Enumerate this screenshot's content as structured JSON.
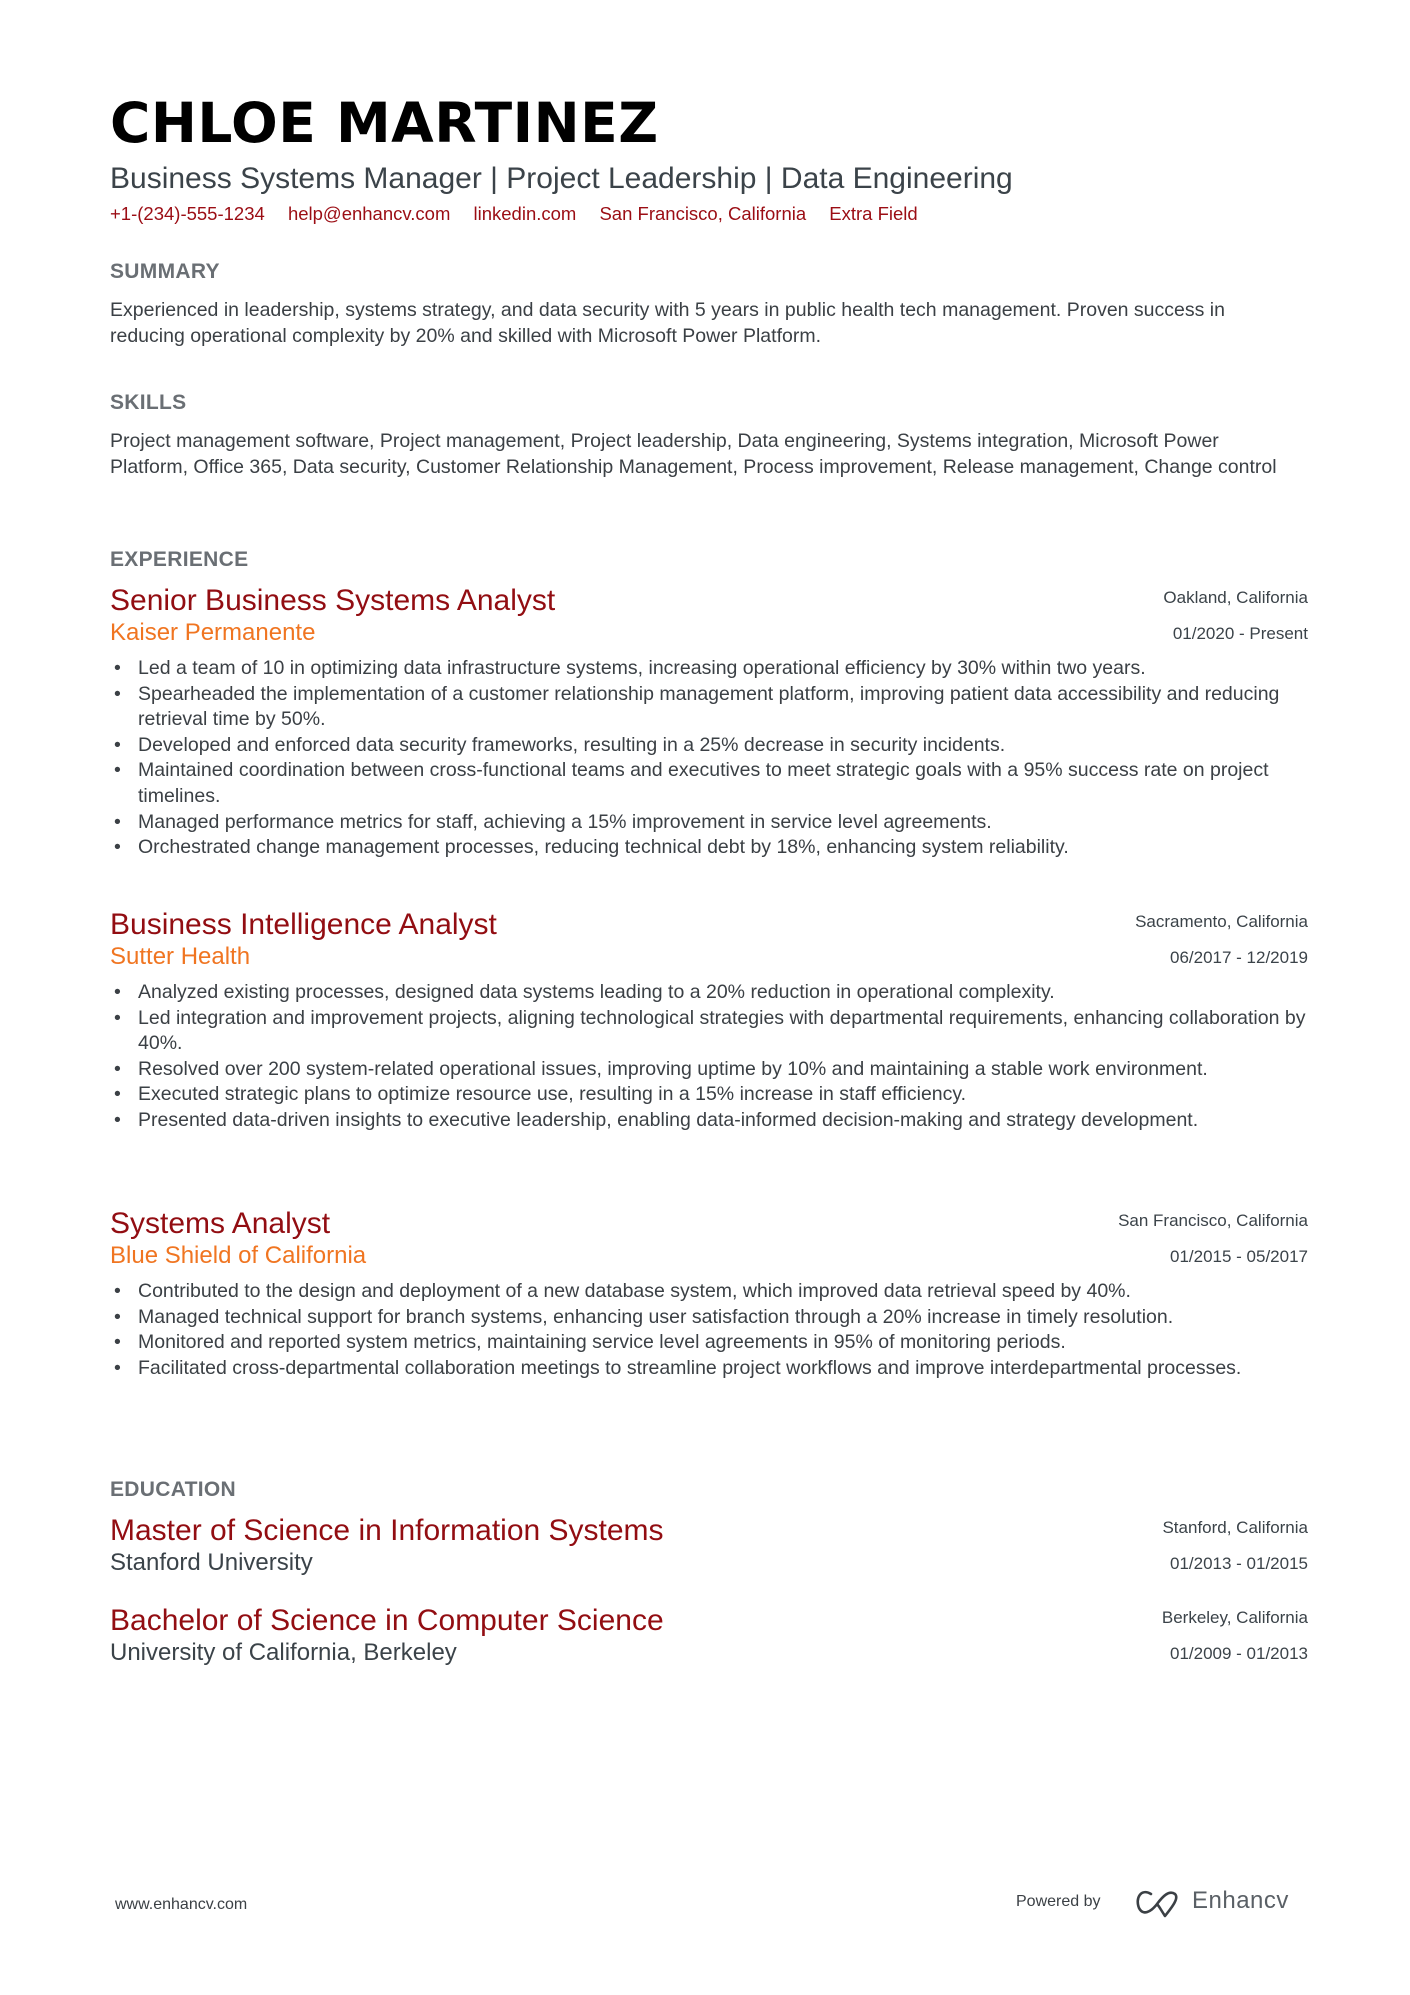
{
  "header": {
    "name": "CHLOE MARTINEZ",
    "subtitle": "Business Systems Manager | Project Leadership | Data Engineering",
    "contacts": [
      "+1-(234)-555-1234",
      "help@enhancv.com",
      "linkedin.com",
      "San Francisco, California",
      "Extra Field"
    ]
  },
  "colors": {
    "title": "#920d12",
    "company": "#f07521",
    "heading": "#6a6f74",
    "contact": "#9b0d14",
    "body": "#3b4045"
  },
  "summary": {
    "heading": "SUMMARY",
    "text": "Experienced in leadership, systems strategy, and data security with 5 years in public health tech management. Proven success in reducing operational complexity by 20% and skilled with Microsoft Power Platform."
  },
  "skills": {
    "heading": "SKILLS",
    "text": "Project management software, Project management, Project leadership, Data engineering, Systems integration, Microsoft Power Platform, Office 365, Data security, Customer Relationship Management, Process improvement, Release management, Change control"
  },
  "experience": {
    "heading": "EXPERIENCE",
    "items": [
      {
        "title": "Senior Business Systems Analyst",
        "company": "Kaiser Permanente",
        "location": "Oakland, California",
        "dates": "01/2020 - Present",
        "bullets": [
          "Led a team of 10 in optimizing data infrastructure systems, increasing operational efficiency by 30% within two years.",
          "Spearheaded the implementation of a customer relationship management platform, improving patient data accessibility and reducing retrieval time by 50%.",
          "Developed and enforced data security frameworks, resulting in a 25% decrease in security incidents.",
          "Maintained coordination between cross-functional teams and executives to meet strategic goals with a 95% success rate on project timelines.",
          "Managed performance metrics for staff, achieving a 15% improvement in service level agreements.",
          "Orchestrated change management processes, reducing technical debt by 18%, enhancing system reliability."
        ]
      },
      {
        "title": "Business Intelligence Analyst",
        "company": "Sutter Health",
        "location": "Sacramento, California",
        "dates": "06/2017 - 12/2019",
        "bullets": [
          "Analyzed existing processes, designed data systems leading to a 20% reduction in operational complexity.",
          "Led integration and improvement projects, aligning technological strategies with departmental requirements, enhancing collaboration by 40%.",
          "Resolved over 200 system-related operational issues, improving uptime by 10% and maintaining a stable work environment.",
          "Executed strategic plans to optimize resource use, resulting in a 15% increase in staff efficiency.",
          "Presented data-driven insights to executive leadership, enabling data-informed decision-making and strategy development."
        ]
      },
      {
        "title": "Systems Analyst",
        "company": "Blue Shield of California",
        "location": "San Francisco, California",
        "dates": "01/2015 - 05/2017",
        "bullets": [
          "Contributed to the design and deployment of a new database system, which improved data retrieval speed by 40%.",
          "Managed technical support for branch systems, enhancing user satisfaction through a 20% increase in timely resolution.",
          "Monitored and reported system metrics, maintaining service level agreements in 95% of monitoring periods.",
          "Facilitated cross-departmental collaboration meetings to streamline project workflows and improve interdepartmental processes."
        ]
      }
    ]
  },
  "education": {
    "heading": "EDUCATION",
    "items": [
      {
        "degree": "Master of Science in Information Systems",
        "school": "Stanford University",
        "location": "Stanford, California",
        "dates": "01/2013 - 01/2015"
      },
      {
        "degree": "Bachelor of Science in Computer Science",
        "school": "University of California, Berkeley",
        "location": "Berkeley, California",
        "dates": "01/2009 - 01/2013"
      }
    ]
  },
  "footer": {
    "url": "www.enhancv.com",
    "powered_by": "Powered by",
    "brand": "Enhancv",
    "logo_icon": "enhancv-logo-icon"
  }
}
